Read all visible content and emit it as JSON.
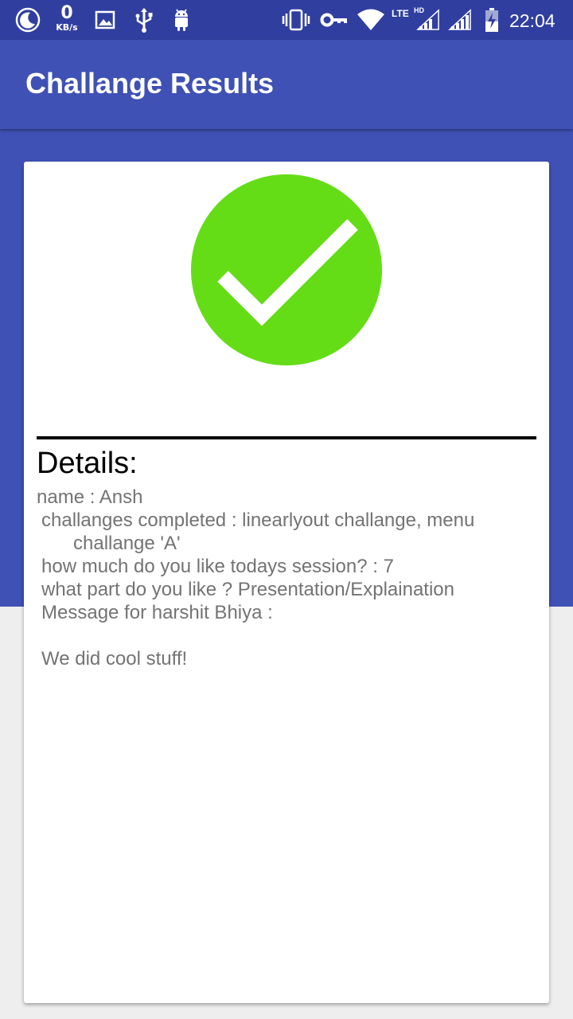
{
  "status_bar": {
    "net_speed_value": "0",
    "net_speed_unit": "KB/s",
    "lte_label": "LTE",
    "hd_label": "HD",
    "time": "22:04",
    "icons": [
      "moon-icon",
      "image-icon",
      "usb-icon",
      "android-icon",
      "vibrate-icon",
      "vpn-key-icon",
      "wifi-icon",
      "signal-icon",
      "battery-charging-icon"
    ]
  },
  "app_bar": {
    "title": "Challange Results"
  },
  "result": {
    "icon": "check-circle-icon",
    "check_color": "#64dd17"
  },
  "details": {
    "heading": "Details:",
    "name_line": "name : Ansh",
    "challenges_line_1": "challanges completed : linearlyout challange, menu",
    "challenges_line_2": "challange 'A'",
    "rating_line": "how much do you like todays session? : 7",
    "part_line": "what part do you like ? Presentation/Explaination",
    "message_label": "Message for harshit Bhiya :",
    "message_text": "We did cool stuff!"
  },
  "colors": {
    "status_bar": "#303f9f",
    "primary": "#3f51b5",
    "background": "#eeeeee",
    "card": "#ffffff",
    "body_text": "#737373"
  }
}
